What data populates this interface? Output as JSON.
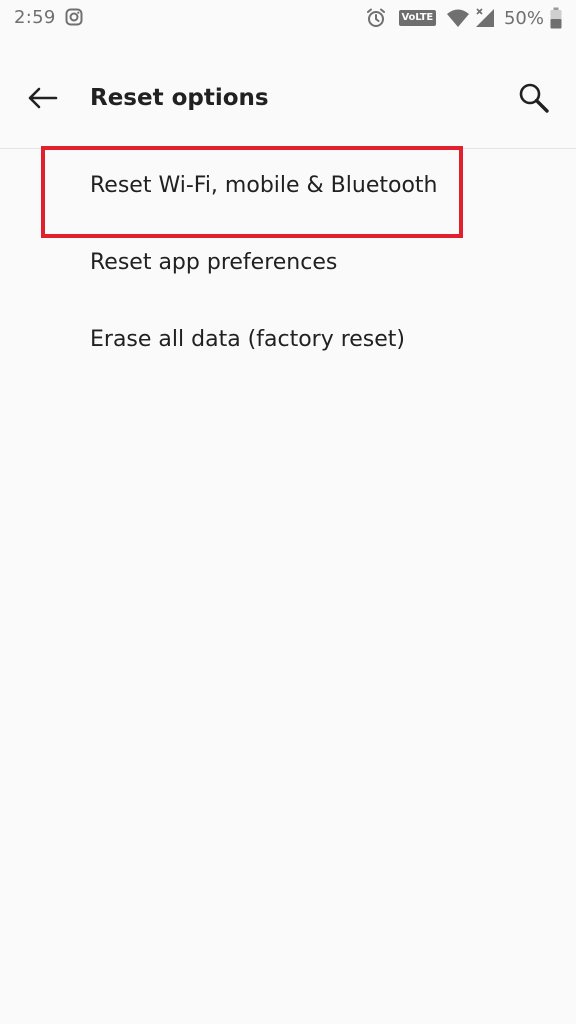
{
  "status_bar": {
    "time": "2:59",
    "volte_label": "VoLTE",
    "battery_percent": "50%",
    "icons": [
      "instagram-icon",
      "alarm-icon",
      "wifi-icon",
      "signal-icon",
      "battery-icon"
    ]
  },
  "toolbar": {
    "title": "Reset options",
    "back_icon": "arrow-left-icon",
    "search_icon": "search-icon"
  },
  "list": {
    "items": [
      {
        "label": "Reset Wi-Fi, mobile & Bluetooth",
        "highlighted": true
      },
      {
        "label": "Reset app preferences",
        "highlighted": false
      },
      {
        "label": "Erase all data (factory reset)",
        "highlighted": false
      }
    ]
  },
  "colors": {
    "background": "#fafafa",
    "text_primary": "#212121",
    "status_text": "#707070",
    "highlight": "#e0202c",
    "divider": "#e4e4e4"
  }
}
